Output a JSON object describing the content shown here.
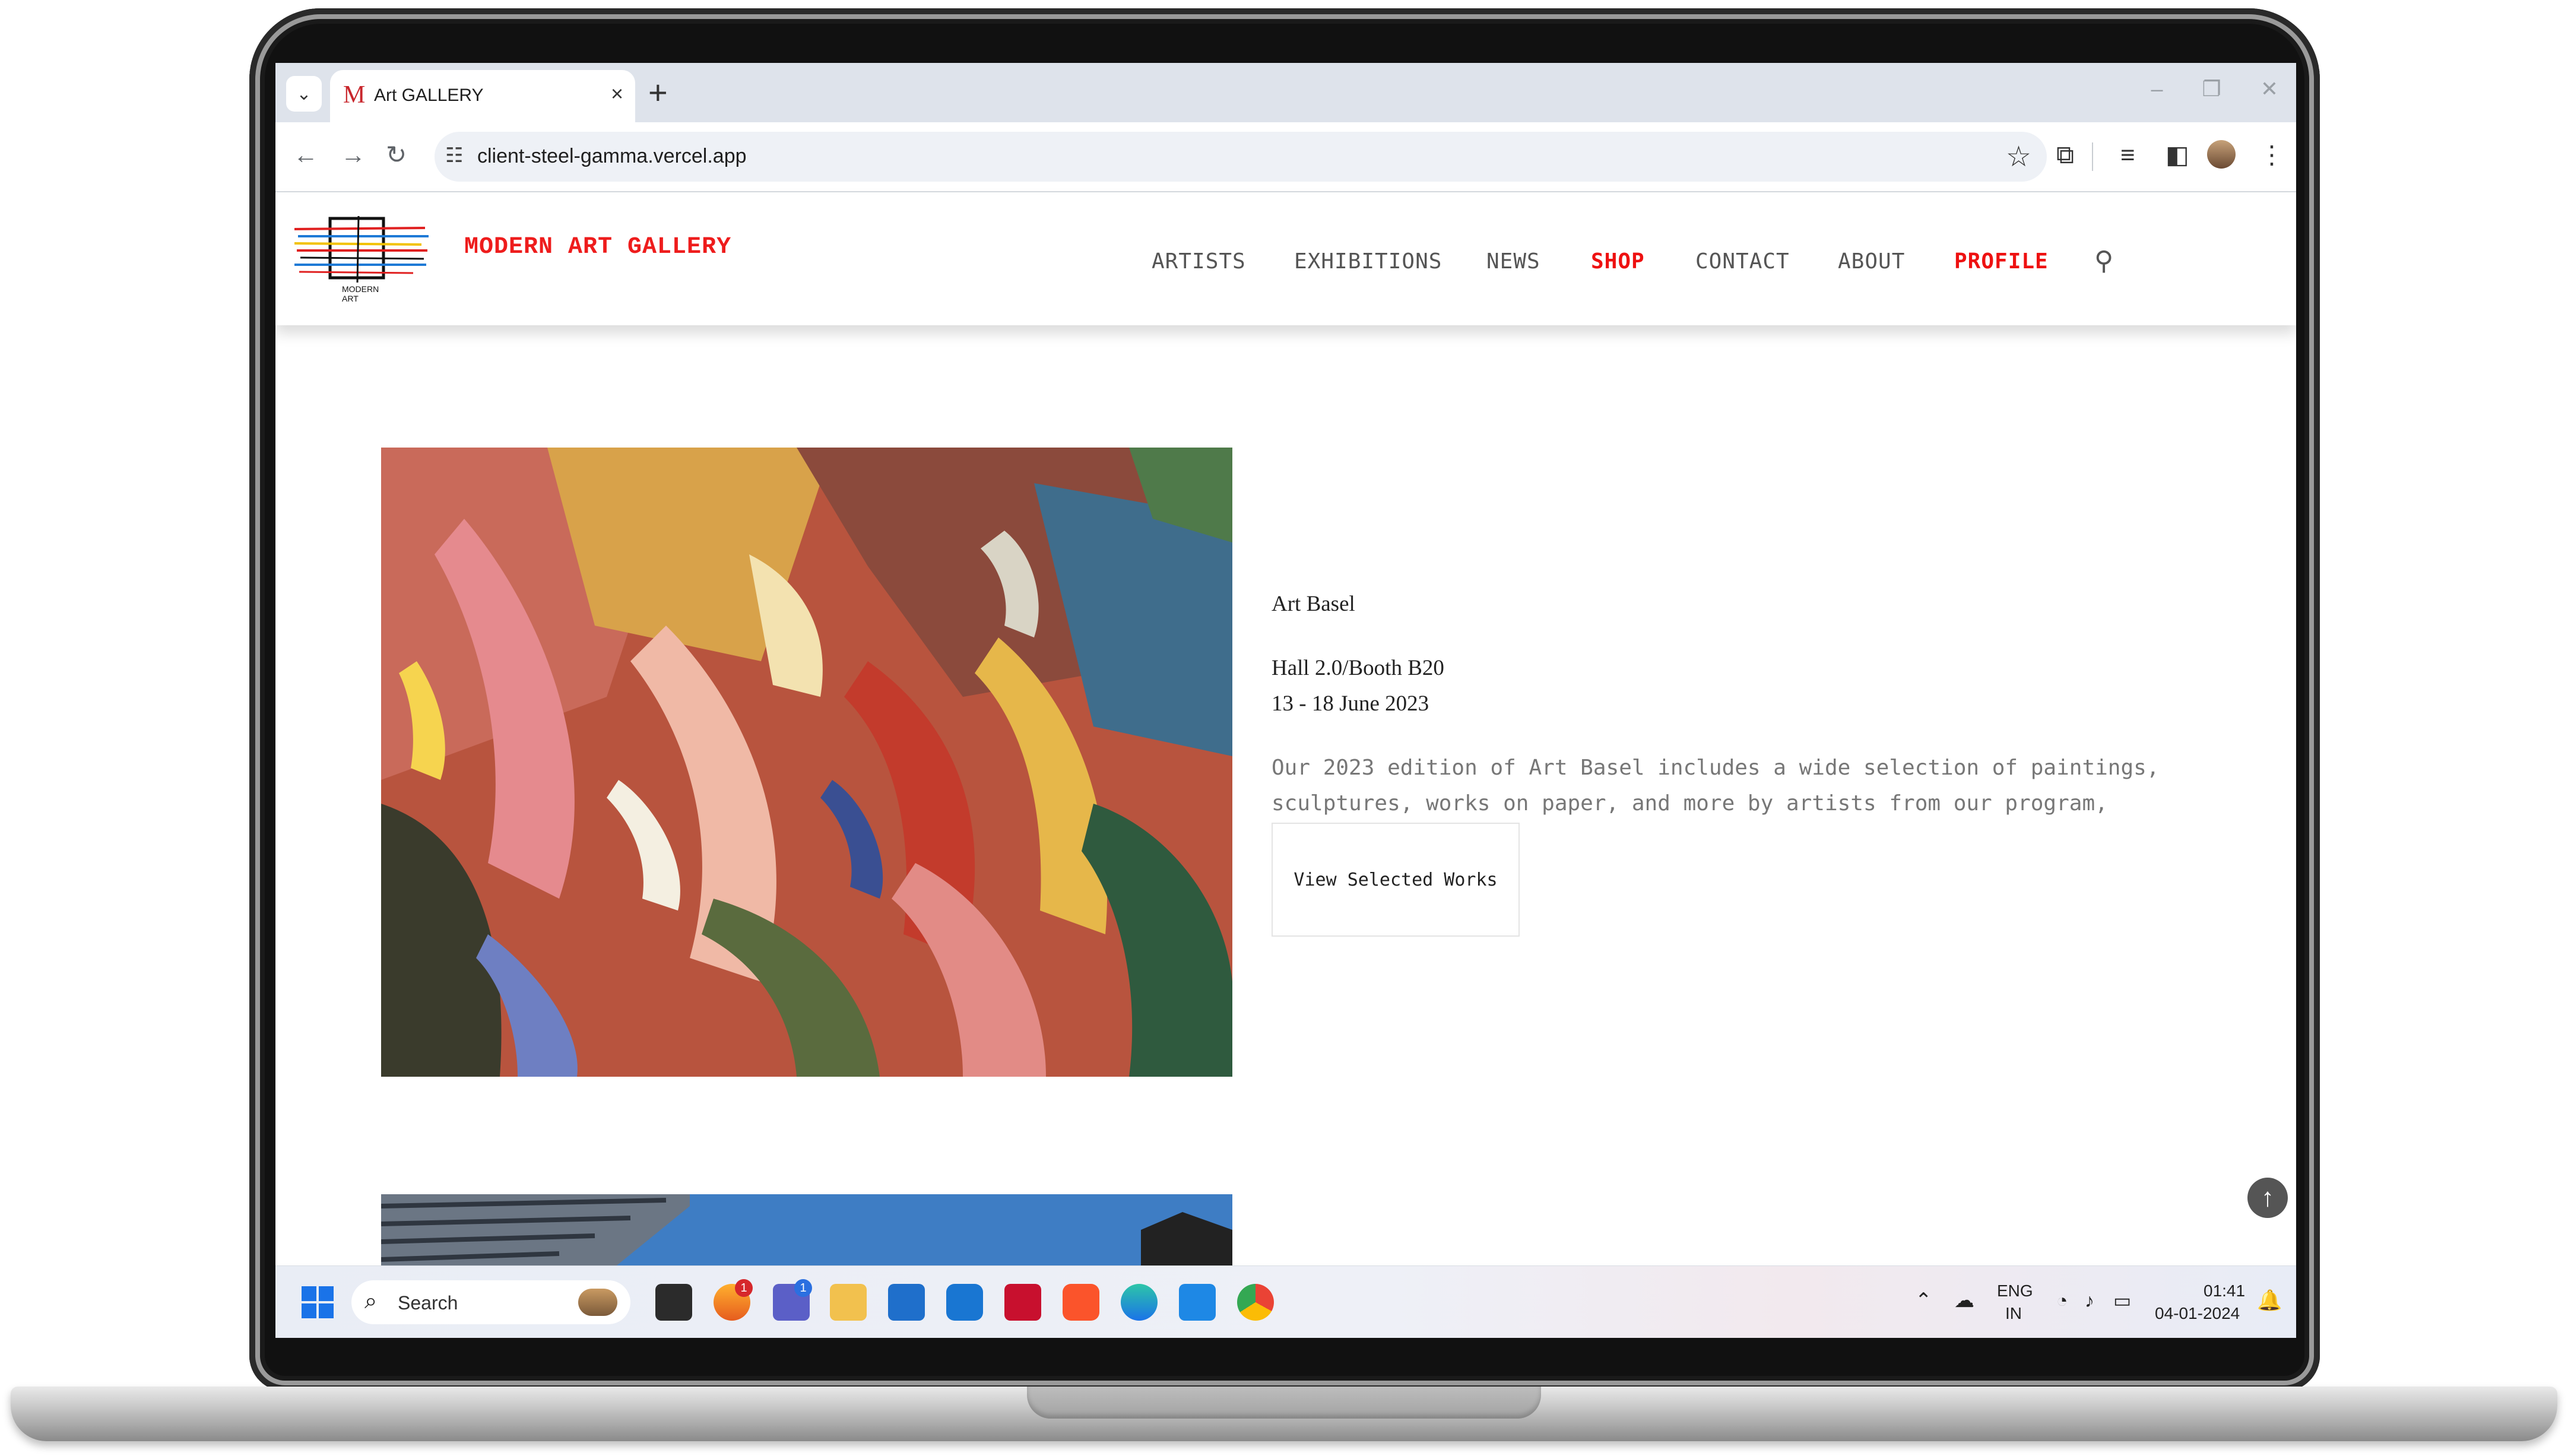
{
  "browser": {
    "tab_title": "Art GALLERY",
    "url": "client-steel-gamma.vercel.app"
  },
  "site": {
    "brand": "MODERN ART GALLERY",
    "logo_caption_top": "MODERN",
    "logo_caption_bottom": "ART",
    "nav": [
      "ARTISTS",
      "EXHIBITIONS",
      "NEWS",
      "SHOP",
      "CONTACT",
      "ABOUT",
      "PROFILE"
    ],
    "accent_color": "#ee1111"
  },
  "exhibition": {
    "name": "Art Basel",
    "location": "Hall 2.0/Booth B20",
    "dates": "13 - 18 June 2023",
    "description_line1": "Our 2023 edition of Art Basel includes a wide selection of paintings,",
    "description_line2": "sculptures, works on paper, and more by artists from our program,",
    "cta_label": "View Selected Works"
  },
  "taskbar": {
    "search_placeholder": "Search",
    "lang_top": "ENG",
    "lang_bottom": "IN",
    "time": "01:41",
    "date": "04-01-2024",
    "badge_teams": "1",
    "badge_firefox": "1"
  }
}
